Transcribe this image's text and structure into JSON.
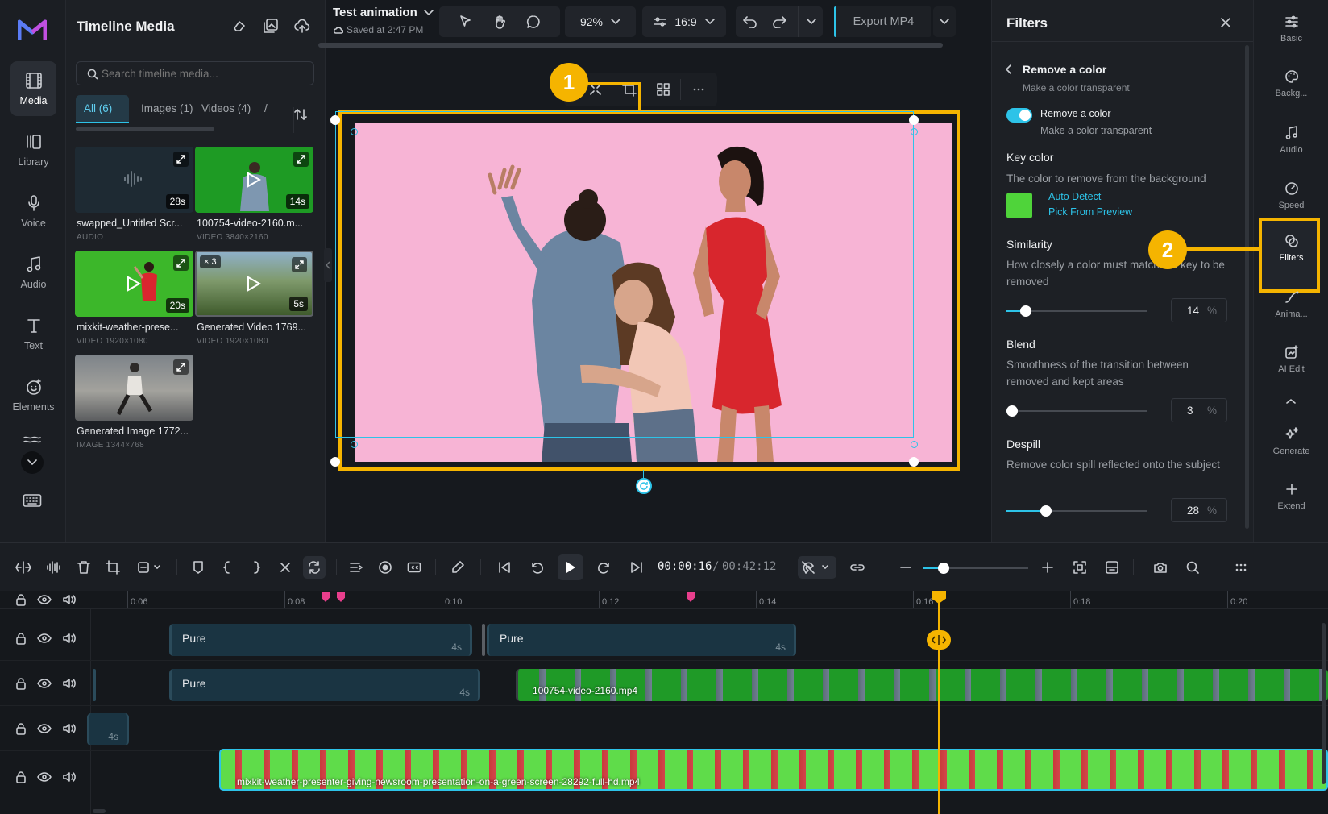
{
  "left_rail": {
    "items": [
      {
        "label": "Media",
        "icon": "film-icon",
        "active": true
      },
      {
        "label": "Library",
        "icon": "library-icon"
      },
      {
        "label": "Voice",
        "icon": "microphone-icon"
      },
      {
        "label": "Audio",
        "icon": "music-note-icon"
      },
      {
        "label": "Text",
        "icon": "text-icon"
      },
      {
        "label": "Elements",
        "icon": "elements-icon"
      }
    ]
  },
  "media": {
    "title": "Timeline Media",
    "search_placeholder": "Search timeline media...",
    "tabs": [
      "All (6)",
      "Images (1)",
      "Videos (4)",
      "/"
    ],
    "items": [
      {
        "name": "swapped_Untitled Scr...",
        "meta": "AUDIO",
        "duration": "28s"
      },
      {
        "name": "100754-video-2160.m...",
        "meta": "VIDEO  3840×2160",
        "duration": "14s"
      },
      {
        "name": "mixkit-weather-prese...",
        "meta": "VIDEO  1920×1080",
        "duration": "20s"
      },
      {
        "name": "Generated Video 1769...",
        "meta": "VIDEO  1920×1080",
        "duration": "5s",
        "badge": "× 3"
      },
      {
        "name": "Generated Image 1772...",
        "meta": "IMAGE  1344×768"
      }
    ]
  },
  "topbar": {
    "project_title": "Test animation",
    "saved": "Saved at 2:47 PM",
    "zoom": "92%",
    "ratio": "16:9",
    "export_label": "Export MP4"
  },
  "callouts": [
    "1",
    "2"
  ],
  "filters": {
    "title": "Filters",
    "section_title": "Remove a color",
    "section_sub": "Make a color transparent",
    "toggle_label": "Remove a color",
    "toggle_sub": "Make a color transparent",
    "key_color": {
      "title": "Key color",
      "desc": "The color to remove from the background",
      "swatch": "#4fd43a",
      "auto_detect": "Auto Detect",
      "pick": "Pick From Preview"
    },
    "similarity": {
      "title": "Similarity",
      "desc": "How closely a color must match the key to be removed",
      "value": "14",
      "unit": "%",
      "level": 0.14
    },
    "blend": {
      "title": "Blend",
      "desc": "Smoothness of the transition between removed and kept areas",
      "value": "3",
      "unit": "%",
      "level": 0.03
    },
    "despill": {
      "title": "Despill",
      "desc": "Remove color spill reflected onto the subject",
      "value": "28",
      "unit": "%",
      "level": 0.28
    }
  },
  "right_rail": {
    "items": [
      {
        "label": "Basic",
        "icon": "sliders-icon"
      },
      {
        "label": "Backg...",
        "icon": "palette-icon"
      },
      {
        "label": "Audio",
        "icon": "music-note-icon"
      },
      {
        "label": "Speed",
        "icon": "speedometer-icon"
      },
      {
        "label": "Filters",
        "icon": "filters-icon",
        "active": true
      },
      {
        "label": "Anima...",
        "icon": "animation-icon"
      },
      {
        "label": "AI Edit",
        "icon": "ai-edit-icon"
      },
      {
        "label": "Generate",
        "icon": "sparkle-icon"
      },
      {
        "label": "Extend",
        "icon": "plus-icon"
      }
    ]
  },
  "timeline": {
    "current_time": "00:00:16",
    "separator": "/",
    "total_time": "00:42:12",
    "ruler": [
      "0:06",
      "0:08",
      "0:10",
      "0:12",
      "0:14",
      "0:16",
      "0:18",
      "0:20"
    ],
    "clips": {
      "pure1": {
        "label": "Pure",
        "dur": "4s"
      },
      "pure2": {
        "label": "Pure",
        "dur": "4s"
      },
      "pure3": {
        "label": "Pure",
        "dur": "4s"
      },
      "short": {
        "dur": "4s"
      },
      "video1": {
        "label": "100754-video-2160.mp4"
      },
      "video2": {
        "label": "mixkit-weather-presenter-giving-newsroom-presentation-on-a-green-screen-28292-full-hd.mp4"
      }
    }
  }
}
